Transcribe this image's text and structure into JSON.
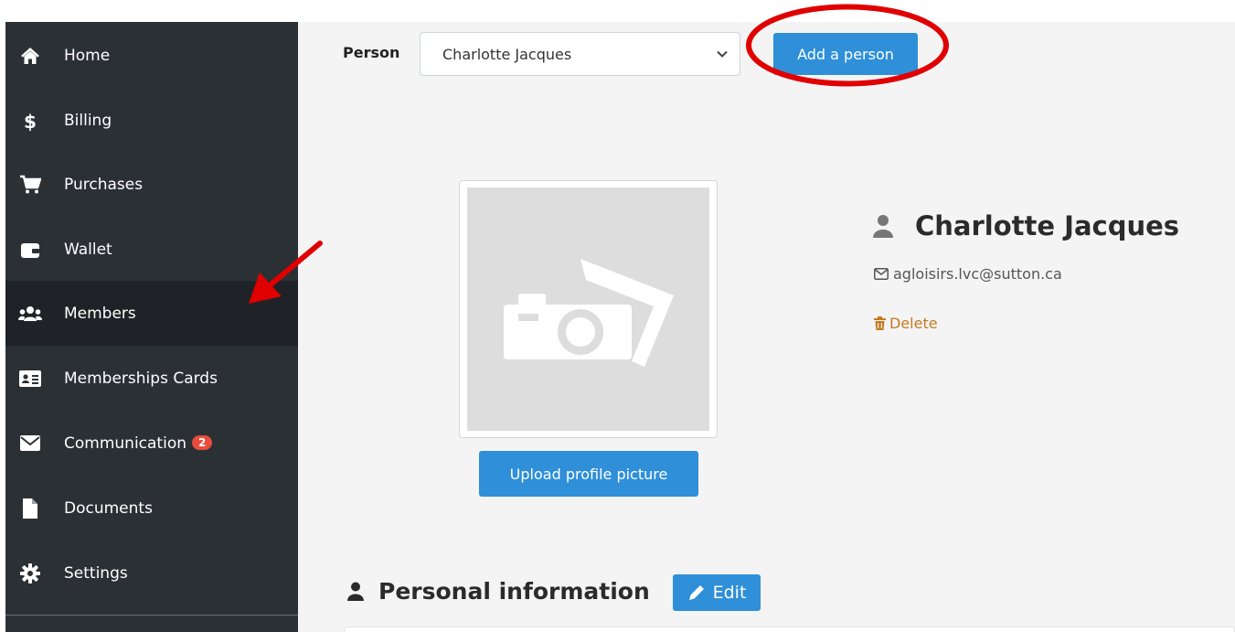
{
  "sidebar": {
    "items": [
      {
        "label": "Home",
        "icon": "home-icon",
        "active": false
      },
      {
        "label": "Billing",
        "icon": "dollar-icon",
        "active": false
      },
      {
        "label": "Purchases",
        "icon": "cart-icon",
        "active": false
      },
      {
        "label": "Wallet",
        "icon": "wallet-icon",
        "active": false
      },
      {
        "label": "Members",
        "icon": "users-icon",
        "active": true
      },
      {
        "label": "Memberships Cards",
        "icon": "id-card-icon",
        "active": false
      },
      {
        "label": "Communication",
        "icon": "envelope-icon",
        "active": false,
        "badge": "2"
      },
      {
        "label": "Documents",
        "icon": "file-icon",
        "active": false
      },
      {
        "label": "Settings",
        "icon": "gear-icon",
        "active": false
      }
    ]
  },
  "toolbar": {
    "person_label": "Person",
    "selected_person": "Charlotte Jacques",
    "add_person_label": "Add a person"
  },
  "profile": {
    "name": "Charlotte Jacques",
    "email": "agloisirs.lvc@sutton.ca",
    "delete_label": "Delete",
    "upload_label": "Upload profile picture"
  },
  "personal_info": {
    "title": "Personal information",
    "edit_label": "Edit"
  },
  "colors": {
    "sidebar_bg": "#2b3035",
    "sidebar_active_bg": "#1f2327",
    "primary_button": "#2f8fd8",
    "badge": "#e74c3c",
    "delete_link": "#c57a1f",
    "annotation_red": "#e00000"
  }
}
